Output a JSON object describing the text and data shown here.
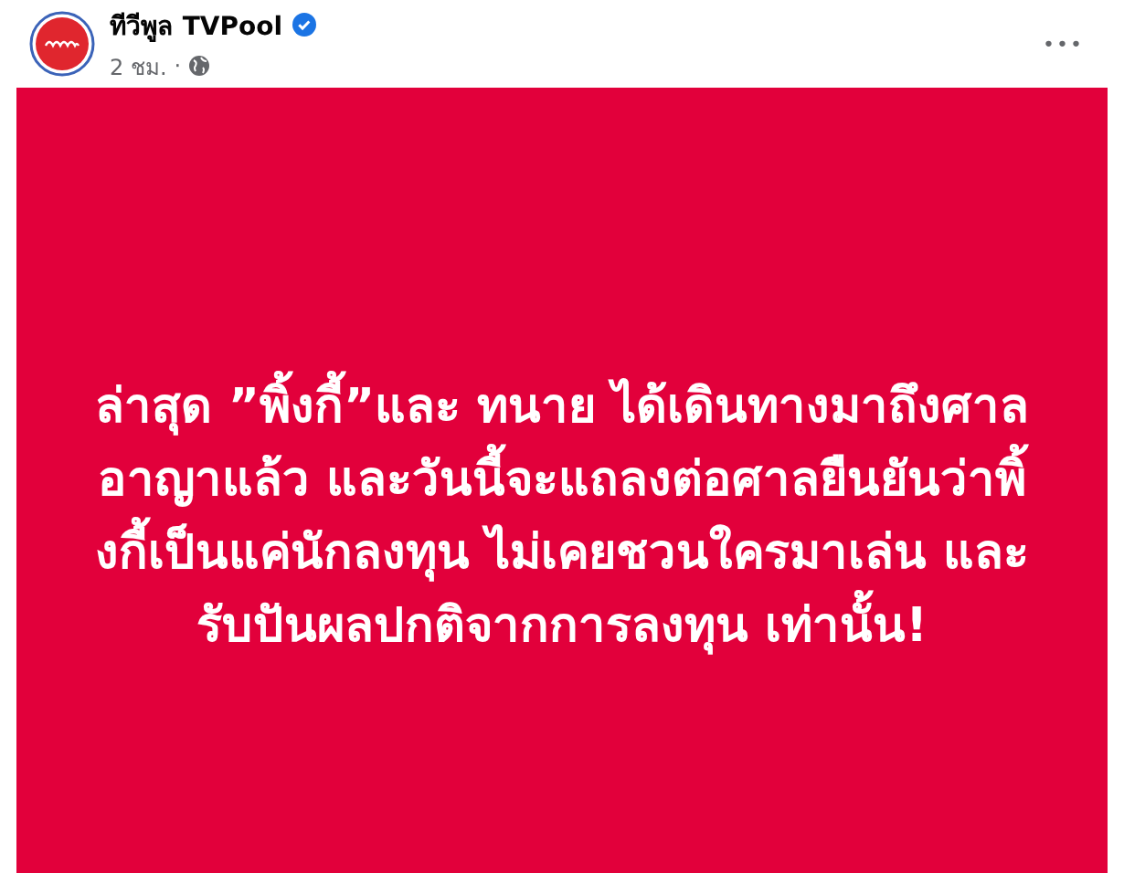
{
  "post": {
    "author": "ทีวีพูล TVPool",
    "verified": true,
    "time": "2 ชม.",
    "separator": "·",
    "menu": "•••",
    "image_text_lines": [
      "ล่าสุด ”พิ้งกี้”และ ทนาย ได้เดินทางมาถึงศาล",
      "อาญาแล้ว และวันนี้จะแถลงต่อศาลยืนยันว่าพิ้",
      "งกี้เป็นแค่นักลงทุน ไม่เคยชวนใครมาเล่น และ",
      "รับปันผลปกติจากการลงทุน เท่านั้น!"
    ]
  }
}
